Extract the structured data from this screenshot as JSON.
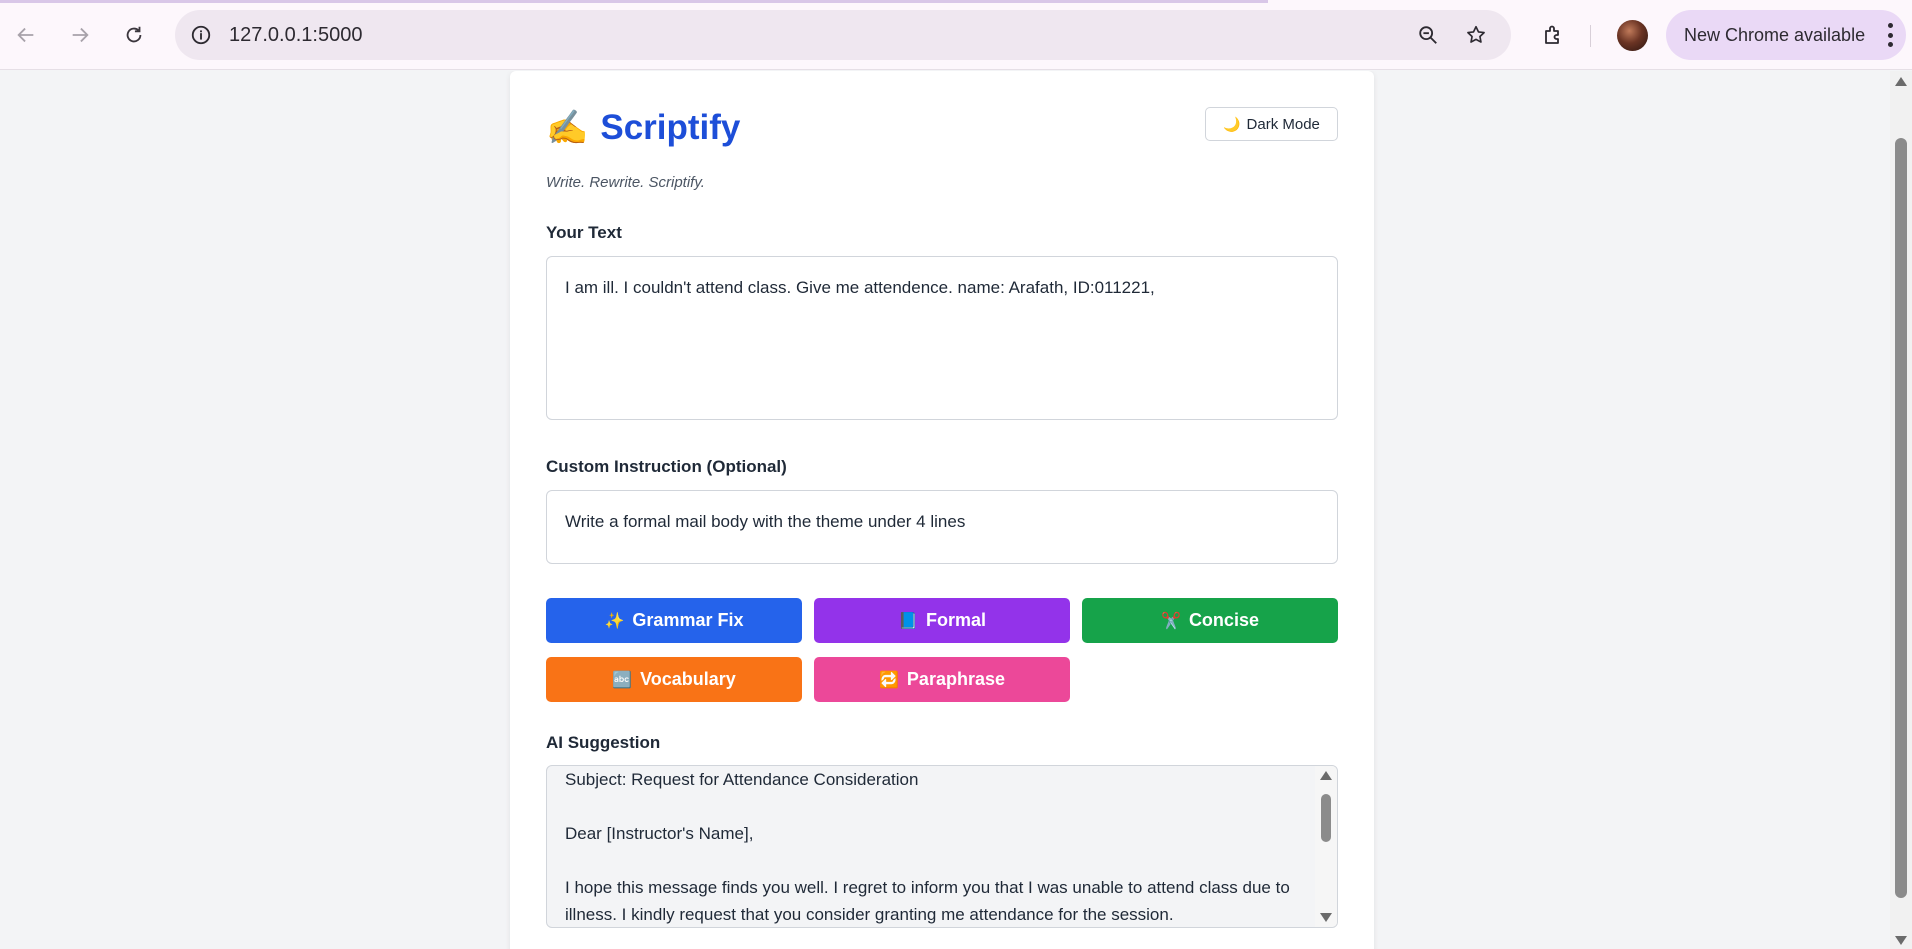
{
  "browser": {
    "url": "127.0.0.1:5000",
    "update_label": "New Chrome available",
    "nav": {
      "back_icon": "arrow-left-icon",
      "forward_icon": "arrow-right-icon",
      "reload_icon": "reload-icon"
    }
  },
  "app": {
    "logo_emoji": "✍️",
    "title": "Scriptify",
    "tagline": "Write. Rewrite. Scriptify.",
    "dark_mode": {
      "icon": "🌙",
      "label": "Dark Mode"
    },
    "accent_color": "#1d4ed8"
  },
  "input": {
    "label": "Your Text",
    "value": "I am ill. I couldn't attend class. Give me attendence. name: Arafath, ID:011221,"
  },
  "instruction": {
    "label": "Custom Instruction (Optional)",
    "value": "Write a formal mail body with the theme under 4 lines"
  },
  "actions": [
    {
      "icon": "✨",
      "label": "Grammar Fix",
      "color": "#2563eb"
    },
    {
      "icon": "📘",
      "label": "Formal",
      "color": "#9333ea"
    },
    {
      "icon": "✂️",
      "label": "Concise",
      "color": "#16a34a"
    },
    {
      "icon": "🔤",
      "label": "Vocabulary",
      "color": "#f97316"
    },
    {
      "icon": "🔁",
      "label": "Paraphrase",
      "color": "#ec4899"
    }
  ],
  "suggestion": {
    "label": "AI Suggestion",
    "lines": [
      "Subject: Request for Attendance Consideration",
      "Dear [Instructor's Name],",
      "I hope this message finds you well. I regret to inform you that I was unable to attend class due to illness. I kindly request that you consider granting me attendance for the session."
    ]
  }
}
